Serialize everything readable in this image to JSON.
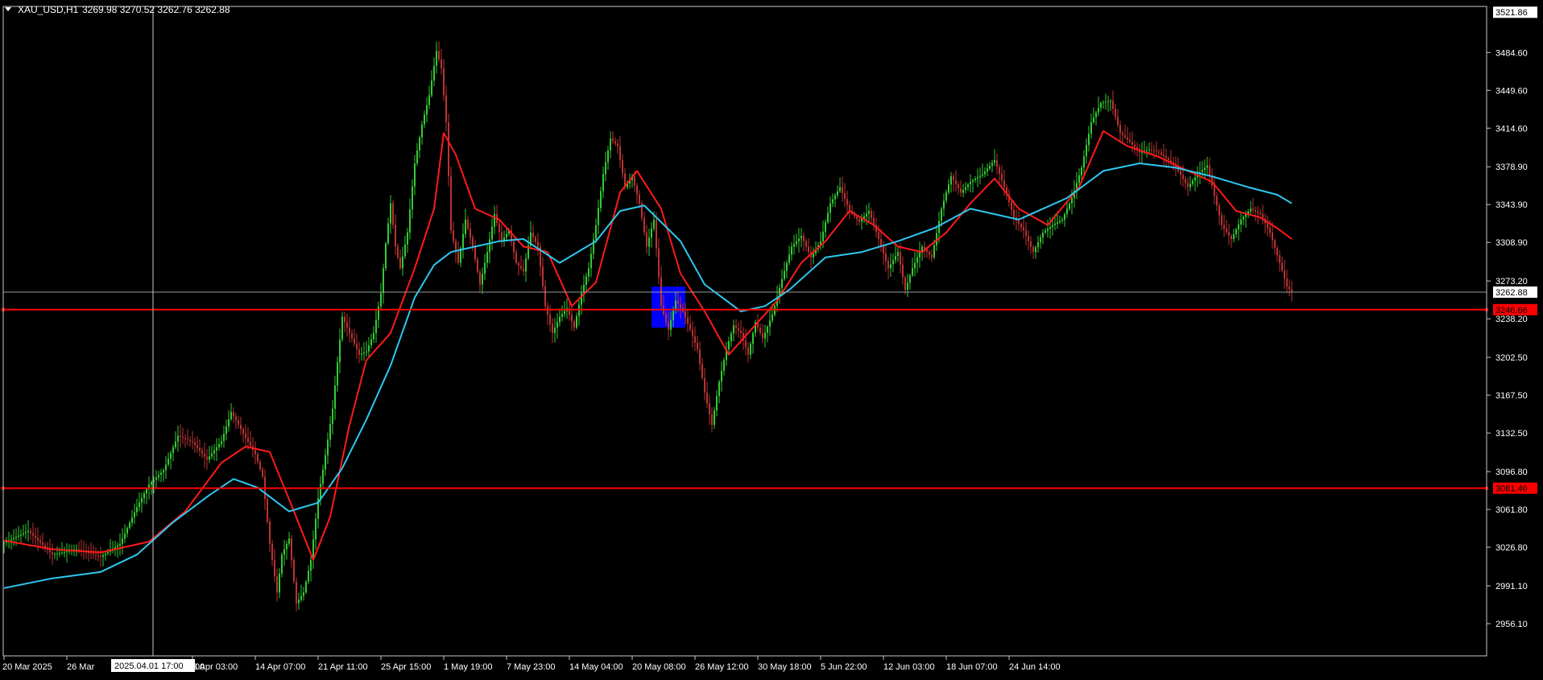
{
  "chart_data": {
    "type": "candlestick",
    "symbol_header": "XAU_USD,H1",
    "ohlc_header": "3269.98 3270.52 3262.76 3262.88",
    "ylim": [
      2936,
      3525
    ],
    "y_ticks": [
      "3521.86",
      "3484.60",
      "3449.60",
      "3414.60",
      "3378.90",
      "3343.90",
      "3308.90",
      "3273.20",
      "3238.20",
      "3202.50",
      "3167.50",
      "3132.50",
      "3096.80",
      "3061.80",
      "3026.80",
      "2991.10",
      "2956.10"
    ],
    "x_ticks": [
      "20 Mar 2025",
      "26 Mar",
      "2025.04.01 17:00",
      "8 Apr 03:00",
      "14 Apr 07:00",
      "21 Apr 11:00",
      "25 Apr 15:00",
      "1 May 19:00",
      "7 May 23:00",
      "14 May 04:00",
      "20 May 08:00",
      "26 May 12:00",
      "30 May 18:00",
      "5 Jun 22:00",
      "12 Jun 03:00",
      "18 Jun 07:00",
      "24 Jun 14:00"
    ],
    "crosshair_time_label": "2025.04.01 17:00",
    "current_price": 3262.88,
    "current_price_label": "3262.88",
    "horizontal_lines": [
      {
        "price": 3246.66,
        "label": "3246.66",
        "color": "#ff0000"
      },
      {
        "price": 3081.46,
        "label": "3081.46",
        "color": "#ff0000"
      }
    ],
    "close_path": [
      [
        0,
        3031
      ],
      [
        10,
        3042
      ],
      [
        20,
        3020
      ],
      [
        30,
        3025
      ],
      [
        40,
        3018
      ],
      [
        48,
        3030
      ],
      [
        55,
        3064
      ],
      [
        60,
        3085
      ],
      [
        66,
        3098
      ],
      [
        72,
        3130
      ],
      [
        78,
        3124
      ],
      [
        84,
        3108
      ],
      [
        90,
        3125
      ],
      [
        94,
        3152
      ],
      [
        97,
        3140
      ],
      [
        100,
        3128
      ],
      [
        104,
        3113
      ],
      [
        107,
        3092
      ],
      [
        110,
        3030
      ],
      [
        113,
        2985
      ],
      [
        115,
        3020
      ],
      [
        118,
        3035
      ],
      [
        121,
        2975
      ],
      [
        124,
        2985
      ],
      [
        127,
        3015
      ],
      [
        130,
        3072
      ],
      [
        133,
        3112
      ],
      [
        136,
        3155
      ],
      [
        138,
        3198
      ],
      [
        140,
        3240
      ],
      [
        143,
        3225
      ],
      [
        147,
        3205
      ],
      [
        150,
        3208
      ],
      [
        153,
        3225
      ],
      [
        156,
        3262
      ],
      [
        158,
        3308
      ],
      [
        160,
        3345
      ],
      [
        162,
        3305
      ],
      [
        164,
        3285
      ],
      [
        167,
        3318
      ],
      [
        170,
        3382
      ],
      [
        173,
        3418
      ],
      [
        176,
        3445
      ],
      [
        179,
        3486
      ],
      [
        181,
        3470
      ],
      [
        183,
        3420
      ],
      [
        185,
        3320
      ],
      [
        188,
        3290
      ],
      [
        191,
        3330
      ],
      [
        194,
        3305
      ],
      [
        197,
        3270
      ],
      [
        200,
        3300
      ],
      [
        203,
        3335
      ],
      [
        206,
        3310
      ],
      [
        209,
        3320
      ],
      [
        212,
        3290
      ],
      [
        215,
        3282
      ],
      [
        218,
        3318
      ],
      [
        221,
        3305
      ],
      [
        224,
        3250
      ],
      [
        227,
        3225
      ],
      [
        230,
        3240
      ],
      [
        233,
        3248
      ],
      [
        236,
        3230
      ],
      [
        239,
        3262
      ],
      [
        242,
        3285
      ],
      [
        245,
        3325
      ],
      [
        248,
        3372
      ],
      [
        251,
        3405
      ],
      [
        254,
        3398
      ],
      [
        257,
        3360
      ],
      [
        260,
        3370
      ],
      [
        263,
        3345
      ],
      [
        266,
        3305
      ],
      [
        269,
        3330
      ],
      [
        272,
        3250
      ],
      [
        275,
        3228
      ],
      [
        278,
        3255
      ],
      [
        281,
        3245
      ],
      [
        284,
        3228
      ],
      [
        287,
        3210
      ],
      [
        290,
        3170
      ],
      [
        293,
        3140
      ],
      [
        296,
        3180
      ],
      [
        299,
        3210
      ],
      [
        302,
        3232
      ],
      [
        305,
        3225
      ],
      [
        308,
        3205
      ],
      [
        311,
        3235
      ],
      [
        314,
        3220
      ],
      [
        318,
        3242
      ],
      [
        322,
        3275
      ],
      [
        326,
        3305
      ],
      [
        330,
        3315
      ],
      [
        334,
        3295
      ],
      [
        338,
        3310
      ],
      [
        342,
        3345
      ],
      [
        346,
        3360
      ],
      [
        350,
        3338
      ],
      [
        354,
        3328
      ],
      [
        358,
        3338
      ],
      [
        362,
        3312
      ],
      [
        366,
        3285
      ],
      [
        370,
        3300
      ],
      [
        373,
        3265
      ],
      [
        376,
        3285
      ],
      [
        380,
        3305
      ],
      [
        384,
        3295
      ],
      [
        388,
        3340
      ],
      [
        392,
        3370
      ],
      [
        396,
        3355
      ],
      [
        400,
        3365
      ],
      [
        405,
        3372
      ],
      [
        410,
        3385
      ],
      [
        414,
        3360
      ],
      [
        418,
        3332
      ],
      [
        422,
        3320
      ],
      [
        426,
        3300
      ],
      [
        430,
        3318
      ],
      [
        434,
        3325
      ],
      [
        438,
        3330
      ],
      [
        442,
        3350
      ],
      [
        446,
        3378
      ],
      [
        450,
        3420
      ],
      [
        454,
        3438
      ],
      [
        458,
        3440
      ],
      [
        462,
        3410
      ],
      [
        466,
        3402
      ],
      [
        470,
        3392
      ],
      [
        474,
        3395
      ],
      [
        478,
        3392
      ],
      [
        482,
        3385
      ],
      [
        486,
        3375
      ],
      [
        490,
        3360
      ],
      [
        494,
        3372
      ],
      [
        498,
        3380
      ],
      [
        501,
        3352
      ],
      [
        504,
        3325
      ],
      [
        508,
        3312
      ],
      [
        512,
        3330
      ],
      [
        516,
        3340
      ],
      [
        520,
        3335
      ],
      [
        524,
        3318
      ],
      [
        528,
        3290
      ],
      [
        531,
        3268
      ],
      [
        533,
        3263
      ]
    ],
    "series": [
      {
        "name": "",
        "color": "#ff1a1a",
        "values": [
          [
            0,
            3033
          ],
          [
            20,
            3025
          ],
          [
            40,
            3022
          ],
          [
            60,
            3032
          ],
          [
            75,
            3060
          ],
          [
            90,
            3105
          ],
          [
            100,
            3120
          ],
          [
            110,
            3115
          ],
          [
            120,
            3060
          ],
          [
            128,
            3015
          ],
          [
            135,
            3055
          ],
          [
            143,
            3140
          ],
          [
            150,
            3200
          ],
          [
            160,
            3225
          ],
          [
            170,
            3285
          ],
          [
            178,
            3340
          ],
          [
            182,
            3410
          ],
          [
            187,
            3390
          ],
          [
            195,
            3340
          ],
          [
            205,
            3330
          ],
          [
            215,
            3305
          ],
          [
            225,
            3300
          ],
          [
            235,
            3250
          ],
          [
            245,
            3272
          ],
          [
            255,
            3355
          ],
          [
            262,
            3375
          ],
          [
            272,
            3340
          ],
          [
            280,
            3280
          ],
          [
            290,
            3245
          ],
          [
            300,
            3205
          ],
          [
            310,
            3230
          ],
          [
            320,
            3255
          ],
          [
            330,
            3290
          ],
          [
            340,
            3310
          ],
          [
            350,
            3338
          ],
          [
            360,
            3325
          ],
          [
            370,
            3305
          ],
          [
            380,
            3300
          ],
          [
            390,
            3318
          ],
          [
            400,
            3345
          ],
          [
            410,
            3368
          ],
          [
            420,
            3340
          ],
          [
            432,
            3325
          ],
          [
            445,
            3360
          ],
          [
            455,
            3412
          ],
          [
            465,
            3398
          ],
          [
            478,
            3388
          ],
          [
            490,
            3375
          ],
          [
            500,
            3365
          ],
          [
            510,
            3338
          ],
          [
            520,
            3332
          ],
          [
            527,
            3322
          ],
          [
            533,
            3312
          ]
        ]
      },
      {
        "name": "",
        "color": "#2ec8f0",
        "values": [
          [
            0,
            2989
          ],
          [
            20,
            2998
          ],
          [
            40,
            3004
          ],
          [
            55,
            3020
          ],
          [
            70,
            3050
          ],
          [
            85,
            3075
          ],
          [
            95,
            3090
          ],
          [
            105,
            3082
          ],
          [
            118,
            3060
          ],
          [
            130,
            3068
          ],
          [
            140,
            3100
          ],
          [
            150,
            3145
          ],
          [
            160,
            3195
          ],
          [
            170,
            3258
          ],
          [
            178,
            3288
          ],
          [
            185,
            3300
          ],
          [
            195,
            3305
          ],
          [
            205,
            3310
          ],
          [
            215,
            3312
          ],
          [
            230,
            3290
          ],
          [
            245,
            3310
          ],
          [
            255,
            3338
          ],
          [
            265,
            3343
          ],
          [
            280,
            3310
          ],
          [
            290,
            3270
          ],
          [
            305,
            3245
          ],
          [
            315,
            3250
          ],
          [
            325,
            3265
          ],
          [
            340,
            3295
          ],
          [
            355,
            3300
          ],
          [
            370,
            3310
          ],
          [
            385,
            3322
          ],
          [
            400,
            3340
          ],
          [
            420,
            3330
          ],
          [
            440,
            3350
          ],
          [
            455,
            3375
          ],
          [
            470,
            3382
          ],
          [
            485,
            3378
          ],
          [
            500,
            3370
          ],
          [
            515,
            3360
          ],
          [
            527,
            3353
          ],
          [
            533,
            3345
          ]
        ]
      }
    ],
    "highlight_box": {
      "x_range": [
        268,
        282
      ],
      "y_range": [
        3230,
        3268
      ],
      "color": "#0000ff"
    },
    "grid": false,
    "legend": "none"
  }
}
